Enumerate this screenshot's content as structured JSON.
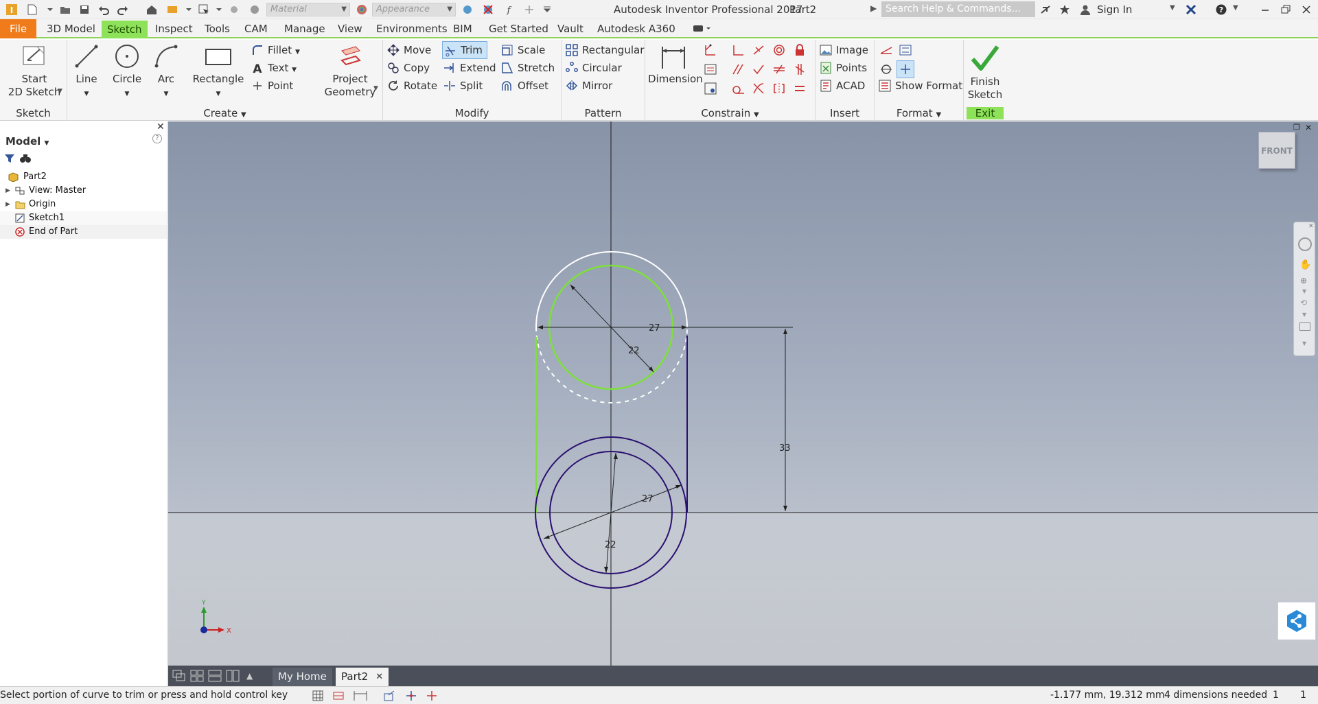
{
  "titlebar": {
    "app_title": "Autodesk Inventor Professional 2017",
    "doc_title": "Part2",
    "material_placeholder": "Material",
    "appearance_placeholder": "Appearance",
    "search_placeholder": "Search Help & Commands...",
    "sign_in": "Sign In"
  },
  "menu": {
    "tabs": [
      "File",
      "3D Model",
      "Sketch",
      "Inspect",
      "Tools",
      "CAM",
      "Manage",
      "View",
      "Environments",
      "BIM",
      "Get Started",
      "Vault",
      "Autodesk A360"
    ],
    "active": "Sketch"
  },
  "ribbon": {
    "sketch_panel": {
      "title": "Sketch",
      "start_sketch": "Start\n2D Sketch"
    },
    "create_panel": {
      "title": "Create",
      "line": "Line",
      "circle": "Circle",
      "arc": "Arc",
      "rectangle": "Rectangle",
      "fillet": "Fillet",
      "text": "Text",
      "point": "Point",
      "project_geometry": "Project\nGeometry"
    },
    "modify_panel": {
      "title": "Modify",
      "move": "Move",
      "copy": "Copy",
      "rotate": "Rotate",
      "trim": "Trim",
      "extend": "Extend",
      "split": "Split",
      "scale": "Scale",
      "stretch": "Stretch",
      "offset": "Offset"
    },
    "pattern_panel": {
      "title": "Pattern",
      "rectangular": "Rectangular",
      "circular": "Circular",
      "mirror": "Mirror"
    },
    "constrain_panel": {
      "title": "Constrain",
      "dimension": "Dimension"
    },
    "insert_panel": {
      "title": "Insert",
      "image": "Image",
      "points": "Points",
      "acad": "ACAD"
    },
    "format_panel": {
      "title": "Format",
      "show_format": "Show Format"
    },
    "exit_panel": {
      "title": "Exit",
      "finish_sketch": "Finish\nSketch"
    }
  },
  "browser": {
    "title": "Model",
    "items": [
      {
        "label": "Part2",
        "icon": "part-icon"
      },
      {
        "label": "View: Master",
        "icon": "view-icon"
      },
      {
        "label": "Origin",
        "icon": "folder-icon"
      },
      {
        "label": "Sketch1",
        "icon": "sketch-icon"
      },
      {
        "label": "End of Part",
        "icon": "end-of-part-icon"
      }
    ]
  },
  "canvas": {
    "viewcube_label": "FRONT",
    "dim_top_diameter_outer": "27",
    "dim_top_diameter_inner": "22",
    "dim_vertical": "33",
    "dim_bottom_diameter_outer": "27",
    "dim_bottom_diameter_inner": "22",
    "triad_y": "Y",
    "triad_x": "X"
  },
  "doc_tabs": {
    "home": "My Home",
    "part": "Part2"
  },
  "status": {
    "prompt": "Select portion of curve to trim or press and hold control key",
    "coords": "-1.177 mm, 19.312 mm",
    "dims_needed": "4 dimensions needed",
    "count_a": "1",
    "count_b": "1"
  },
  "colors": {
    "accent_green": "#8ee25a",
    "file_orange": "#f07b1a",
    "sketch_purple": "#2a1070",
    "selected_green": "#7ee03a"
  }
}
